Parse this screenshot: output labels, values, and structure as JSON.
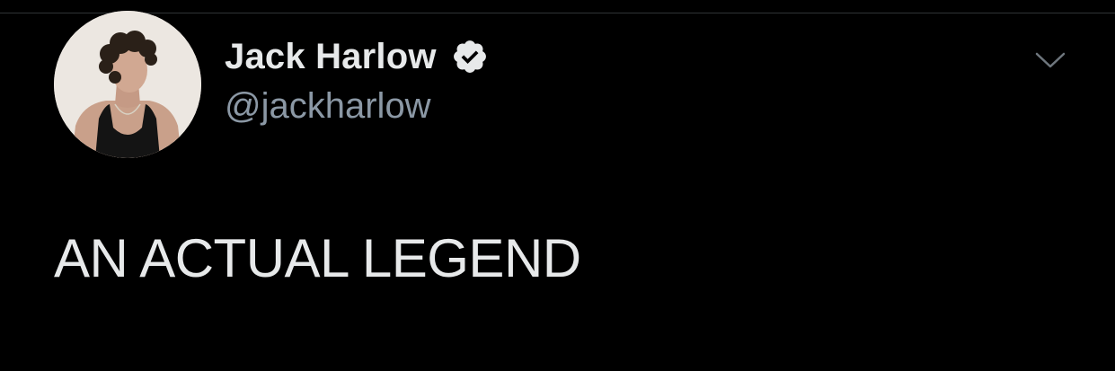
{
  "tweet": {
    "author": {
      "display_name": "Jack Harlow",
      "handle": "@jackharlow",
      "verified": true
    },
    "text": "AN ACTUAL LEGEND"
  },
  "icons": {
    "verified": "verified-badge-icon",
    "more": "chevron-down-icon",
    "avatar": "profile-photo"
  },
  "colors": {
    "background": "#000000",
    "text_primary": "#e7e9ea",
    "text_secondary": "#8b98a5"
  }
}
